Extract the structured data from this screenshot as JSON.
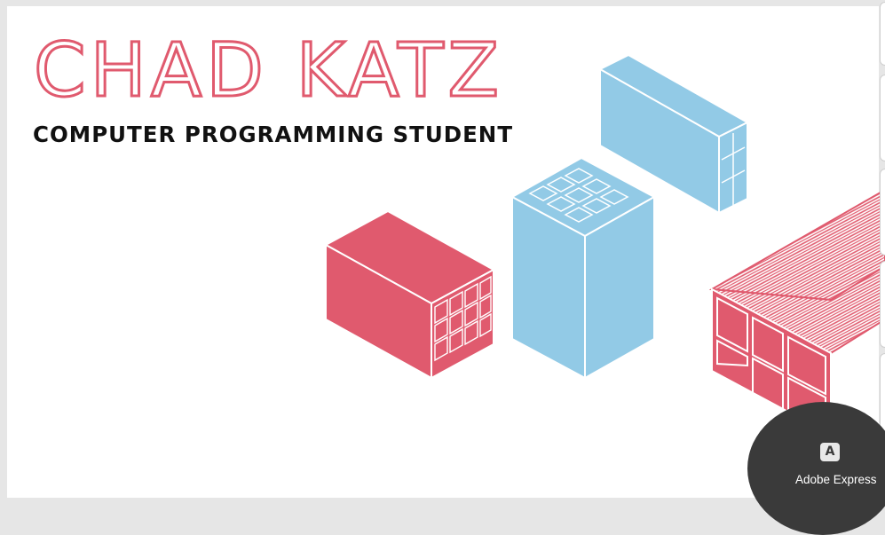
{
  "slide": {
    "title": "CHAD KATZ",
    "subtitle": "COMPUTER PROGRAMMING STUDENT"
  },
  "badge": {
    "icon": "adobe-express-icon",
    "label": "Adobe Express"
  },
  "colors": {
    "red": "#e05a6e",
    "blue": "#92cae6",
    "badge": "#3a3a3a"
  }
}
